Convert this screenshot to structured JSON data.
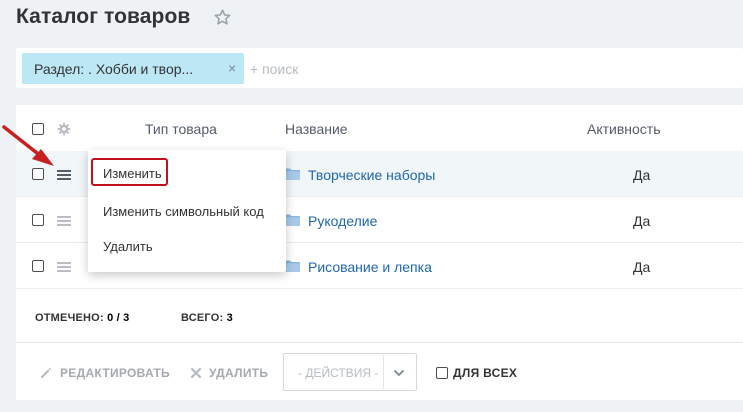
{
  "header": {
    "title": "Каталог товаров"
  },
  "filter": {
    "chip_label": "Раздел: . Хобби и твор...",
    "chip_close": "×",
    "search_placeholder": "+ поиск"
  },
  "grid": {
    "columns": [
      "Тип товара",
      "Название",
      "Активность"
    ],
    "rows": [
      {
        "name": "Творческие наборы",
        "active": "Да"
      },
      {
        "name": "Рукоделие",
        "active": "Да"
      },
      {
        "name": "Рисование и лепка",
        "active": "Да"
      }
    ],
    "selected_label": "ОТМЕЧЕНО:",
    "selected_value": "0 / 3",
    "total_label": "ВСЕГО:",
    "total_value": "3"
  },
  "context_menu": {
    "items": [
      "Изменить",
      "Изменить символьный код",
      "Удалить"
    ]
  },
  "action_panel": {
    "edit_label": "РЕДАКТИРОВАТЬ",
    "delete_label": "УДАЛИТЬ",
    "actions_placeholder": "- ДЕЙСТВИЯ -",
    "for_all_label": "ДЛЯ ВСЕХ"
  },
  "colors": {
    "accent_link": "#2067b0",
    "highlight": "#c1111a",
    "chip": "#bce8f6"
  }
}
